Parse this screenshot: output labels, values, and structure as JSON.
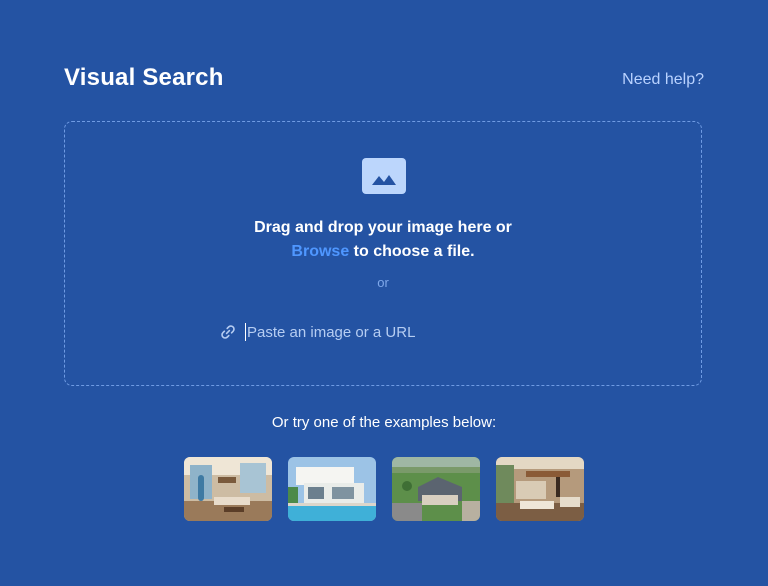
{
  "header": {
    "title": "Visual Search",
    "help_link": "Need help?"
  },
  "dropzone": {
    "icon": "image-icon",
    "line1": "Drag and drop your image here or",
    "browse_label": "Browse",
    "line2_suffix": " to choose a file.",
    "or_label": "or",
    "url_icon": "link-icon",
    "url_placeholder": "Paste an image or a URL",
    "url_value": ""
  },
  "examples": {
    "label": "Or try one of the examples below:",
    "items": [
      "example-image-interior-living-room",
      "example-image-modern-house-pool",
      "example-image-aerial-house",
      "example-image-interior-loft"
    ]
  },
  "colors": {
    "background": "#2453a3",
    "accent": "#4f97ff",
    "muted_link": "#b9d2ff"
  }
}
